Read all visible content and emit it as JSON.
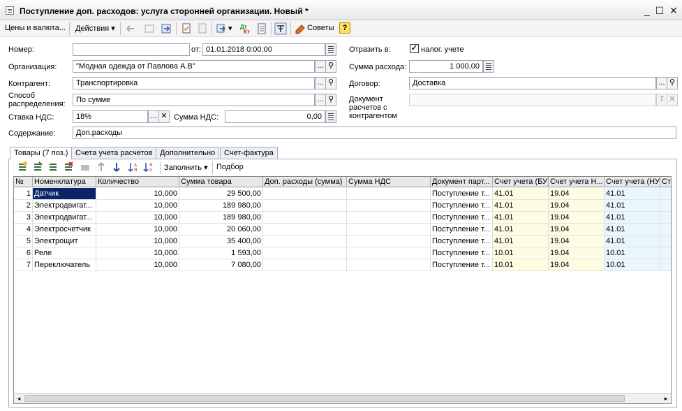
{
  "window": {
    "title": "Поступление доп. расходов: услуга сторонней организации. Новый *",
    "min": "_",
    "max": "☐",
    "close": "✕"
  },
  "toolbar": {
    "prices": "Цены и валюта...",
    "actions": "Действия",
    "tips": "Советы",
    "help": "?"
  },
  "form": {
    "number_label": "Номер:",
    "number_value": "",
    "date_label": "от:",
    "date_value": "01.01.2018  0:00:00",
    "reflect_label": "Отразить в:",
    "tax_label": "налог. учете",
    "tax_checked": "✓",
    "org_label": "Организация:",
    "org_value": "\"Модная одежда от Павлова А.В\"",
    "expense_label": "Сумма расхода:",
    "expense_value": "1 000,00",
    "contractor_label": "Контрагент:",
    "contractor_value": "Транспортировка",
    "contract_label": "Договор:",
    "contract_value": "Доставка",
    "dist_label_1": "Способ",
    "dist_label_2": "распределения:",
    "dist_value": "По сумме",
    "doc_label_1": "Документ",
    "doc_label_2": "расчетов с",
    "doc_label_3": "контрагентом",
    "doc_value": "",
    "vat_rate_label": "Ставка НДС:",
    "vat_rate_value": "18%",
    "vat_sum_label": "Сумма НДС:",
    "vat_sum_value": "0,00",
    "content_label": "Содержание:",
    "content_value": "Доп.расходы",
    "ellipsis": "...",
    "clear": "✕",
    "search": "⚲",
    "t_btn": "T"
  },
  "tabs": [
    "Товары (7 поз.)",
    "Счета учета расчетов",
    "Дополнительно",
    "Счет-фактура"
  ],
  "table_toolbar": {
    "fill": "Заполнить",
    "select": "Подбор"
  },
  "columns": [
    "№",
    "Номенклатура",
    "Количество",
    "Сумма товара",
    "Доп. расходы (сумма)",
    "Сумма НДС",
    "Документ парт...",
    "Счет учета (БУ)",
    "Счет учета Н...",
    "Счет учета (НУ)",
    "Ст"
  ],
  "rows": [
    {
      "n": "1",
      "name": "Датчик",
      "qty": "10,000",
      "sum": "29 500,00",
      "doc": "Поступление т...",
      "bu": "41.01",
      "nds": "19.04",
      "nu": "41.01"
    },
    {
      "n": "2",
      "name": "Электродвигат...",
      "qty": "10,000",
      "sum": "189 980,00",
      "doc": "Поступление т...",
      "bu": "41.01",
      "nds": "19.04",
      "nu": "41.01"
    },
    {
      "n": "3",
      "name": "Электродвигат...",
      "qty": "10,000",
      "sum": "189 980,00",
      "doc": "Поступление т...",
      "bu": "41.01",
      "nds": "19.04",
      "nu": "41.01"
    },
    {
      "n": "4",
      "name": "Электросчетчик",
      "qty": "10,000",
      "sum": "20 060,00",
      "doc": "Поступление т...",
      "bu": "41.01",
      "nds": "19.04",
      "nu": "41.01"
    },
    {
      "n": "5",
      "name": "Электрощит",
      "qty": "10,000",
      "sum": "35 400,00",
      "doc": "Поступление т...",
      "bu": "41.01",
      "nds": "19.04",
      "nu": "41.01"
    },
    {
      "n": "6",
      "name": "Реле",
      "qty": "10,000",
      "sum": "1 593,00",
      "doc": "Поступление т...",
      "bu": "10.01",
      "nds": "19.04",
      "nu": "10.01"
    },
    {
      "n": "7",
      "name": "Переключатель",
      "qty": "10,000",
      "sum": "7 080,00",
      "doc": "Поступление т...",
      "bu": "10.01",
      "nds": "19.04",
      "nu": "10.01"
    }
  ]
}
